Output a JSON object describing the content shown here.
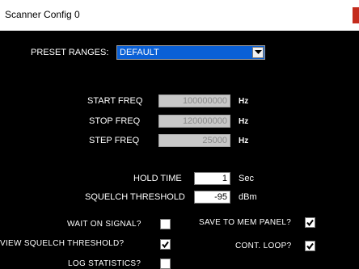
{
  "window": {
    "title": "Scanner Config 0"
  },
  "preset": {
    "label": "PRESET RANGES:",
    "value": "DEFAULT"
  },
  "freq": {
    "start_label": "START FREQ",
    "start_value": "100000000",
    "stop_label": "STOP FREQ",
    "stop_value": "120000000",
    "step_label": "STEP FREQ",
    "step_value": "25000",
    "unit": "Hz"
  },
  "hold": {
    "label": "HOLD TIME",
    "value": "1",
    "unit": "Sec"
  },
  "squelch": {
    "label": "SQUELCH THRESHOLD",
    "value": "-95",
    "unit": "dBm"
  },
  "options": {
    "wait_on_signal": {
      "label": "WAIT ON SIGNAL?",
      "checked": false
    },
    "save_to_mem_panel": {
      "label": "SAVE TO MEM PANEL?",
      "checked": true
    },
    "view_squelch_threshold": {
      "label": "VIEW SQUELCH THRESHOLD?",
      "checked": true
    },
    "cont_loop": {
      "label": "CONT. LOOP?",
      "checked": true
    },
    "log_statistics": {
      "label": "LOG STATISTICS?",
      "checked": false
    }
  },
  "colors": {
    "background": "#000000",
    "select_highlight": "#0a60d6",
    "close": "#c42b1c"
  }
}
